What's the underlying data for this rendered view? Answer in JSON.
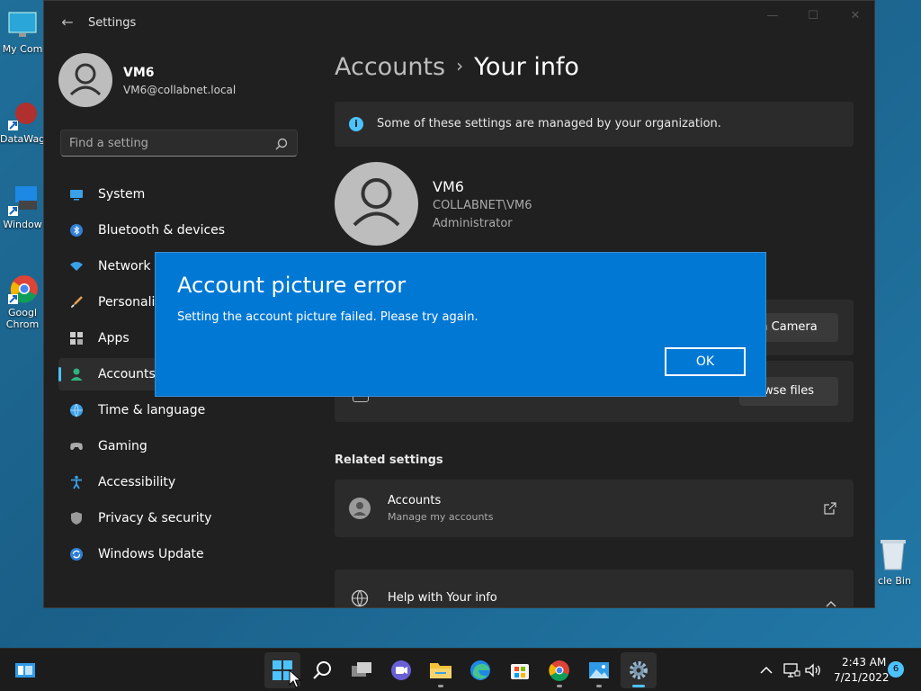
{
  "desktop": {
    "icons": [
      {
        "label": "My Com"
      },
      {
        "label": "DataWag"
      },
      {
        "label": "Window"
      },
      {
        "label": "Googl"
      },
      {
        "label": "Chrom"
      }
    ],
    "recycle_bin_label": "cle Bin"
  },
  "settings": {
    "window_title": "Settings",
    "profile": {
      "name": "VM6",
      "email": "VM6@collabnet.local"
    },
    "search": {
      "placeholder": "Find a setting"
    },
    "nav": [
      {
        "label": "System",
        "icon": "system-icon"
      },
      {
        "label": "Bluetooth & devices",
        "icon": "bluetooth-icon"
      },
      {
        "label": "Network &",
        "icon": "network-icon"
      },
      {
        "label": "Personaliz",
        "icon": "brush-icon"
      },
      {
        "label": "Apps",
        "icon": "apps-icon"
      },
      {
        "label": "Accounts",
        "icon": "accounts-icon",
        "active": true
      },
      {
        "label": "Time & language",
        "icon": "globe-icon"
      },
      {
        "label": "Gaming",
        "icon": "gamepad-icon"
      },
      {
        "label": "Accessibility",
        "icon": "accessibility-icon"
      },
      {
        "label": "Privacy & security",
        "icon": "shield-icon"
      },
      {
        "label": "Windows Update",
        "icon": "update-icon"
      }
    ],
    "breadcrumb": {
      "parent": "Accounts",
      "separator": "›",
      "current": "Your info"
    },
    "info_banner": "Some of these settings are managed by your organization.",
    "user": {
      "name": "VM6",
      "domain": "COLLABNET\\VM6",
      "role": "Administrator"
    },
    "camera_button": "n Camera",
    "browse_button": "wse files",
    "related_settings": {
      "title": "Related settings",
      "item_title": "Accounts",
      "item_subtitle": "Manage my accounts"
    },
    "help": {
      "title": "Help with Your info"
    }
  },
  "dialog": {
    "title": "Account picture error",
    "message": "Setting the account picture failed. Please try again.",
    "ok_label": "OK"
  },
  "taskbar": {
    "time": "2:43 AM",
    "date": "7/21/2022",
    "notification_count": "6"
  },
  "colors": {
    "accent": "#0078d4",
    "accent_light": "#4cc2ff",
    "window_bg": "#202020",
    "card_bg": "#2b2b2b"
  }
}
